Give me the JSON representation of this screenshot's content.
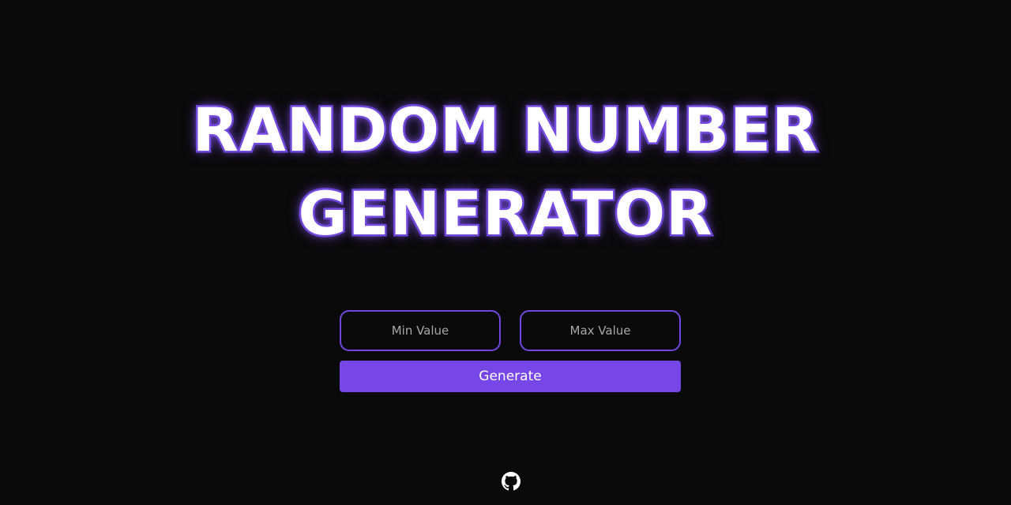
{
  "header": {
    "title_line_1": "RANDOM NUMBER",
    "title_line_2": "GENERATOR"
  },
  "form": {
    "min_placeholder": "Min Value",
    "min_value": "",
    "max_placeholder": "Max Value",
    "max_value": "",
    "generate_label": "Generate"
  },
  "footer": {
    "icon": "github-icon"
  },
  "colors": {
    "background": "#0a0a0a",
    "accent": "#7646e6",
    "title_text": "#ffffff",
    "title_outline": "#6c46d8"
  }
}
